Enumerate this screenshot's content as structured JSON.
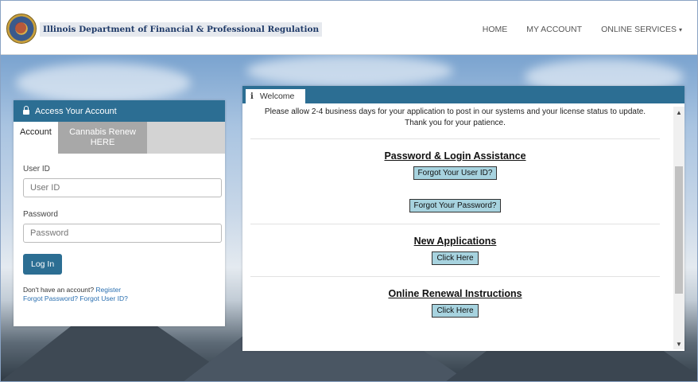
{
  "header": {
    "brand": "Illinois Department of Financial & Professional Regulation",
    "nav": {
      "home": "HOME",
      "account": "MY ACCOUNT",
      "services": "ONLINE SERVICES",
      "services_caret": "▾"
    }
  },
  "login": {
    "title": "Access Your Account",
    "tabs": {
      "account": "Account",
      "cannabis": "Cannabis Renew HERE"
    },
    "user_id_label": "User ID",
    "user_id_placeholder": "User ID",
    "password_label": "Password",
    "password_placeholder": "Password",
    "login_button": "Log In",
    "no_account": "Don't have an account?",
    "register": "Register",
    "forgot_password": "Forgot Password?",
    "forgot_user_id": "Forgot User ID?"
  },
  "welcome": {
    "tab_icon": "i",
    "tab_label": "Welcome",
    "notice_line1": "Please allow 2-4 business days for your application to post in our systems and your license status to update.",
    "notice_line2": "Thank you for your patience.",
    "sections": [
      {
        "title": "Password & Login Assistance",
        "buttons": [
          "Forgot Your User ID?",
          "Forgot Your Password?"
        ]
      },
      {
        "title": "New Applications",
        "buttons": [
          "Click Here"
        ]
      },
      {
        "title": "Online Renewal Instructions",
        "buttons": [
          "Click Here"
        ]
      }
    ],
    "scroll_up": "▲",
    "scroll_down": "▼"
  }
}
